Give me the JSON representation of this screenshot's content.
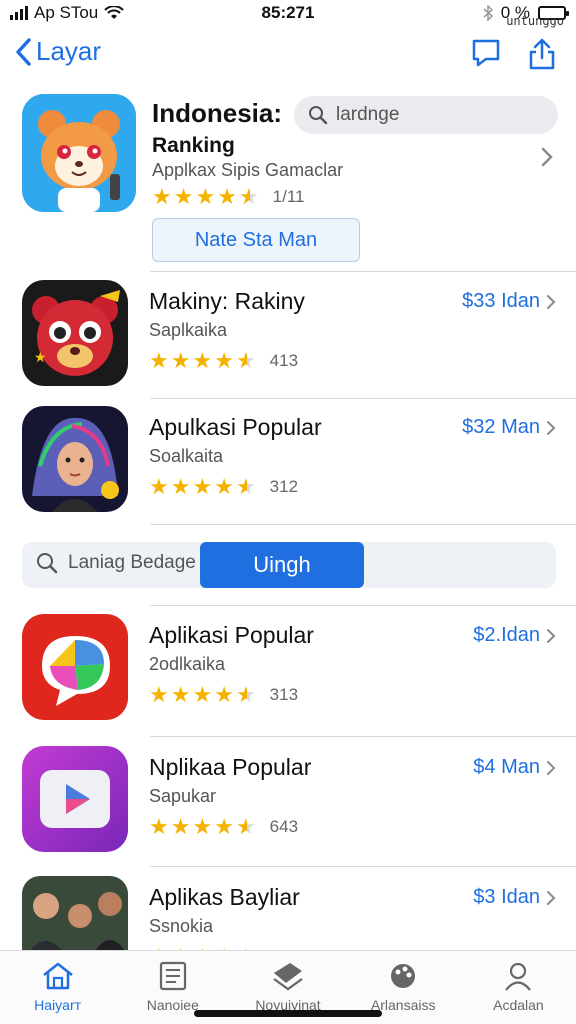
{
  "status_bar": {
    "carrier": "Ap STou",
    "time": "85:271",
    "battery_text": "0 %",
    "watermark": "untunggo",
    "battery_level": 0.6,
    "colors": {
      "battery_fill": "#34c759"
    }
  },
  "nav": {
    "back_label": "Layar",
    "icons": [
      "chevron-left-icon",
      "chat-bubble-icon",
      "share-icon"
    ],
    "accent": "#1f6fe0"
  },
  "featured": {
    "title": "Indonesia:",
    "subtitle": "Ranking",
    "description": "Applkax Sipis Gamaclar",
    "rating": 4.5,
    "rating_count": "1/11",
    "get_button_label": "Nate Sta Man",
    "search_placeholder": "lardnge",
    "icon": "hamster-character-icon"
  },
  "apps": [
    {
      "name": "Makiny: Rakiny",
      "category": "Saplkaika",
      "rating": 4.5,
      "rating_count": "413",
      "price": "$33 Idan",
      "icon": "red-bear-icon"
    },
    {
      "name": "Apulkasi Popular",
      "category": "Soalkaita",
      "rating": 4.5,
      "rating_count": "312",
      "price": "$32 Man",
      "icon": "woman-portrait-icon"
    },
    {
      "name": "Aplikasi Popular",
      "category": "2odlkaika",
      "rating": 4.5,
      "rating_count": "313",
      "price": "$2.Idan",
      "icon": "chat-bubble-colorful-icon"
    },
    {
      "name": "Nplikaa Popular",
      "category": "Sapukar",
      "rating": 4.5,
      "rating_count": "643",
      "price": "$4 Man",
      "icon": "play-button-icon"
    },
    {
      "name": "Aplikas Bayliar",
      "category": "Ssnokia",
      "rating": 4.5,
      "rating_count": "",
      "price": "$3 Idan",
      "icon": "people-photo-icon"
    }
  ],
  "filter": {
    "search_label": "Laniag Bedage",
    "button_label": "Uingh"
  },
  "tabs": [
    {
      "label": "Haiyarт",
      "icon": "home-icon",
      "active": true
    },
    {
      "label": "Nanoiee",
      "icon": "document-list-icon",
      "active": false
    },
    {
      "label": "Noyuiyinat",
      "icon": "layers-icon",
      "active": false
    },
    {
      "label": "Arlansaiss",
      "icon": "palette-icon",
      "active": false
    },
    {
      "label": "Acdalan",
      "icon": "person-icon",
      "active": false
    }
  ]
}
